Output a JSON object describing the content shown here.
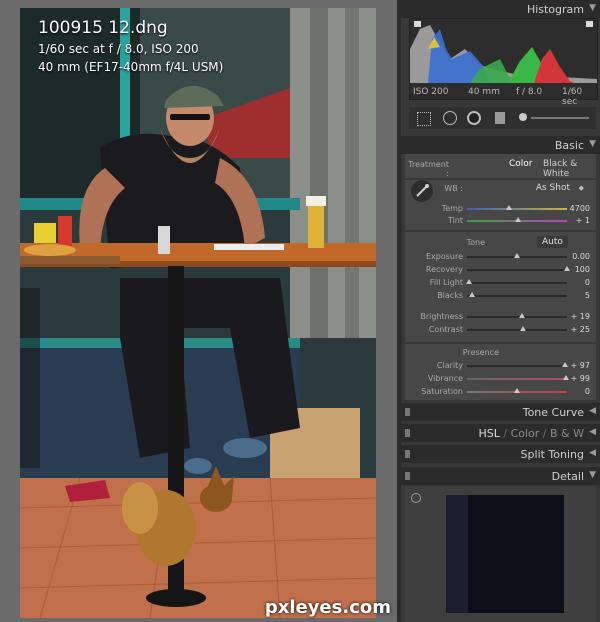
{
  "photo": {
    "title": "100915 12.dng",
    "exposure_line": "1/60 sec at f / 8.0, ISO 200",
    "lens_line": "40 mm (EF17-40mm f/4L USM)"
  },
  "watermark": "pxleyes.com",
  "histogram": {
    "title": "Histogram",
    "iso": "ISO 200",
    "focal": "40 mm",
    "aperture": "f / 8.0",
    "shutter": "1/60 sec"
  },
  "basic": {
    "title": "Basic",
    "treatment_label": "Treatment :",
    "color_option": "Color",
    "bw_option": "Black & White",
    "wb_label": "WB :",
    "wb_value": "As Shot",
    "temp_label": "Temp",
    "temp_value": "4700",
    "tint_label": "Tint",
    "tint_value": "+ 1",
    "tone_label": "Tone",
    "auto_label": "Auto",
    "exposure_label": "Exposure",
    "exposure_value": "0.00",
    "recovery_label": "Recovery",
    "recovery_value": "100",
    "filllight_label": "Fill Light",
    "filllight_value": "0",
    "blacks_label": "Blacks",
    "blacks_value": "5",
    "brightness_label": "Brightness",
    "brightness_value": "+ 19",
    "contrast_label": "Contrast",
    "contrast_value": "+ 25",
    "presence_label": "Presence",
    "clarity_label": "Clarity",
    "clarity_value": "+ 97",
    "vibrance_label": "Vibrance",
    "vibrance_value": "+ 99",
    "saturation_label": "Saturation",
    "saturation_value": "0"
  },
  "sliders": {
    "temp": 0.42,
    "tint": 0.51,
    "exposure": 0.5,
    "recovery": 1.0,
    "filllight": 0.02,
    "blacks": 0.05,
    "brightness": 0.55,
    "contrast": 0.56,
    "clarity": 0.98,
    "vibrance": 0.99,
    "saturation": 0.5
  },
  "panels": {
    "tone_curve": "Tone Curve",
    "hsl": "HSL",
    "color": "Color",
    "bw": "B & W",
    "split_toning": "Split Toning",
    "detail": "Detail"
  }
}
